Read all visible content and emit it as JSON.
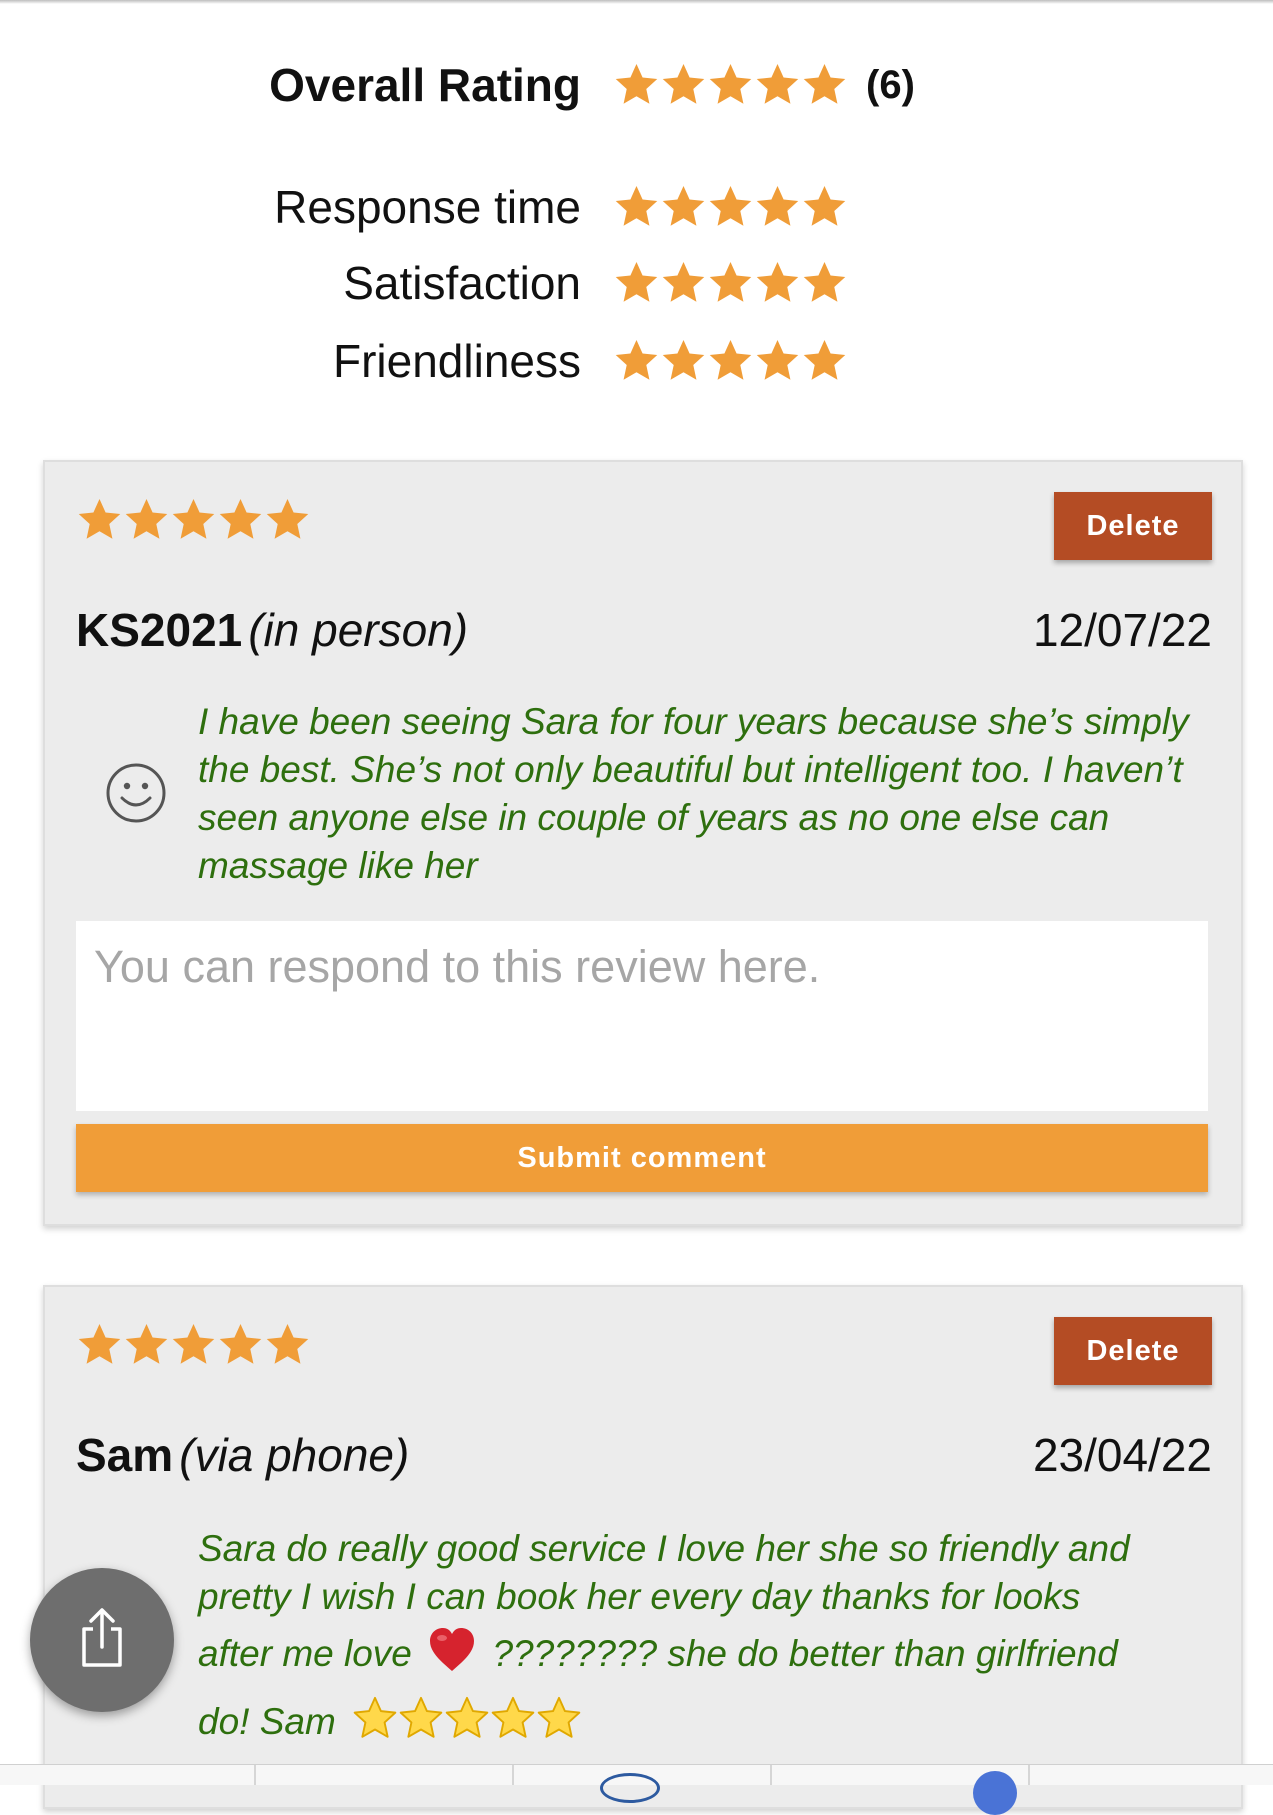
{
  "summary": {
    "overall_label": "Overall Rating",
    "overall_rating": 5,
    "overall_count": "(6)",
    "criteria": [
      {
        "label": "Response time",
        "rating": 5
      },
      {
        "label": "Satisfaction",
        "rating": 5
      },
      {
        "label": "Friendliness",
        "rating": 5
      }
    ],
    "star_color": "#f09d38"
  },
  "reviews": [
    {
      "rating": 5,
      "delete_label": "Delete",
      "name": "KS2021",
      "method": "(in person)",
      "date": "12/07/22",
      "icon": "smiley-icon",
      "text": "I have been seeing Sara for four years because she’s simply the best. She’s not only beautiful but intelligent too. I haven’t seen anyone else in couple of years as no one else can massage like her",
      "reply_placeholder": "You can respond to this review here.",
      "submit_label": "Submit comment"
    },
    {
      "rating": 5,
      "delete_label": "Delete",
      "name": "Sam",
      "method": "(via phone)",
      "date": "23/04/22",
      "text_lines": [
        "Sara do really good service I love her she so friendly and",
        "pretty I wish I can book her every day thanks for looks",
        "after me love",
        "???????? she do better than girlfriend",
        "do! Sam"
      ],
      "inline_icons": [
        "heart-icon",
        "star-emoji-icon"
      ]
    }
  ],
  "share_icon": "share-icon",
  "colors": {
    "delete": "#b44c24",
    "submit": "#f09d38",
    "review_text": "#2e6f0e",
    "card_bg": "#ececec"
  }
}
